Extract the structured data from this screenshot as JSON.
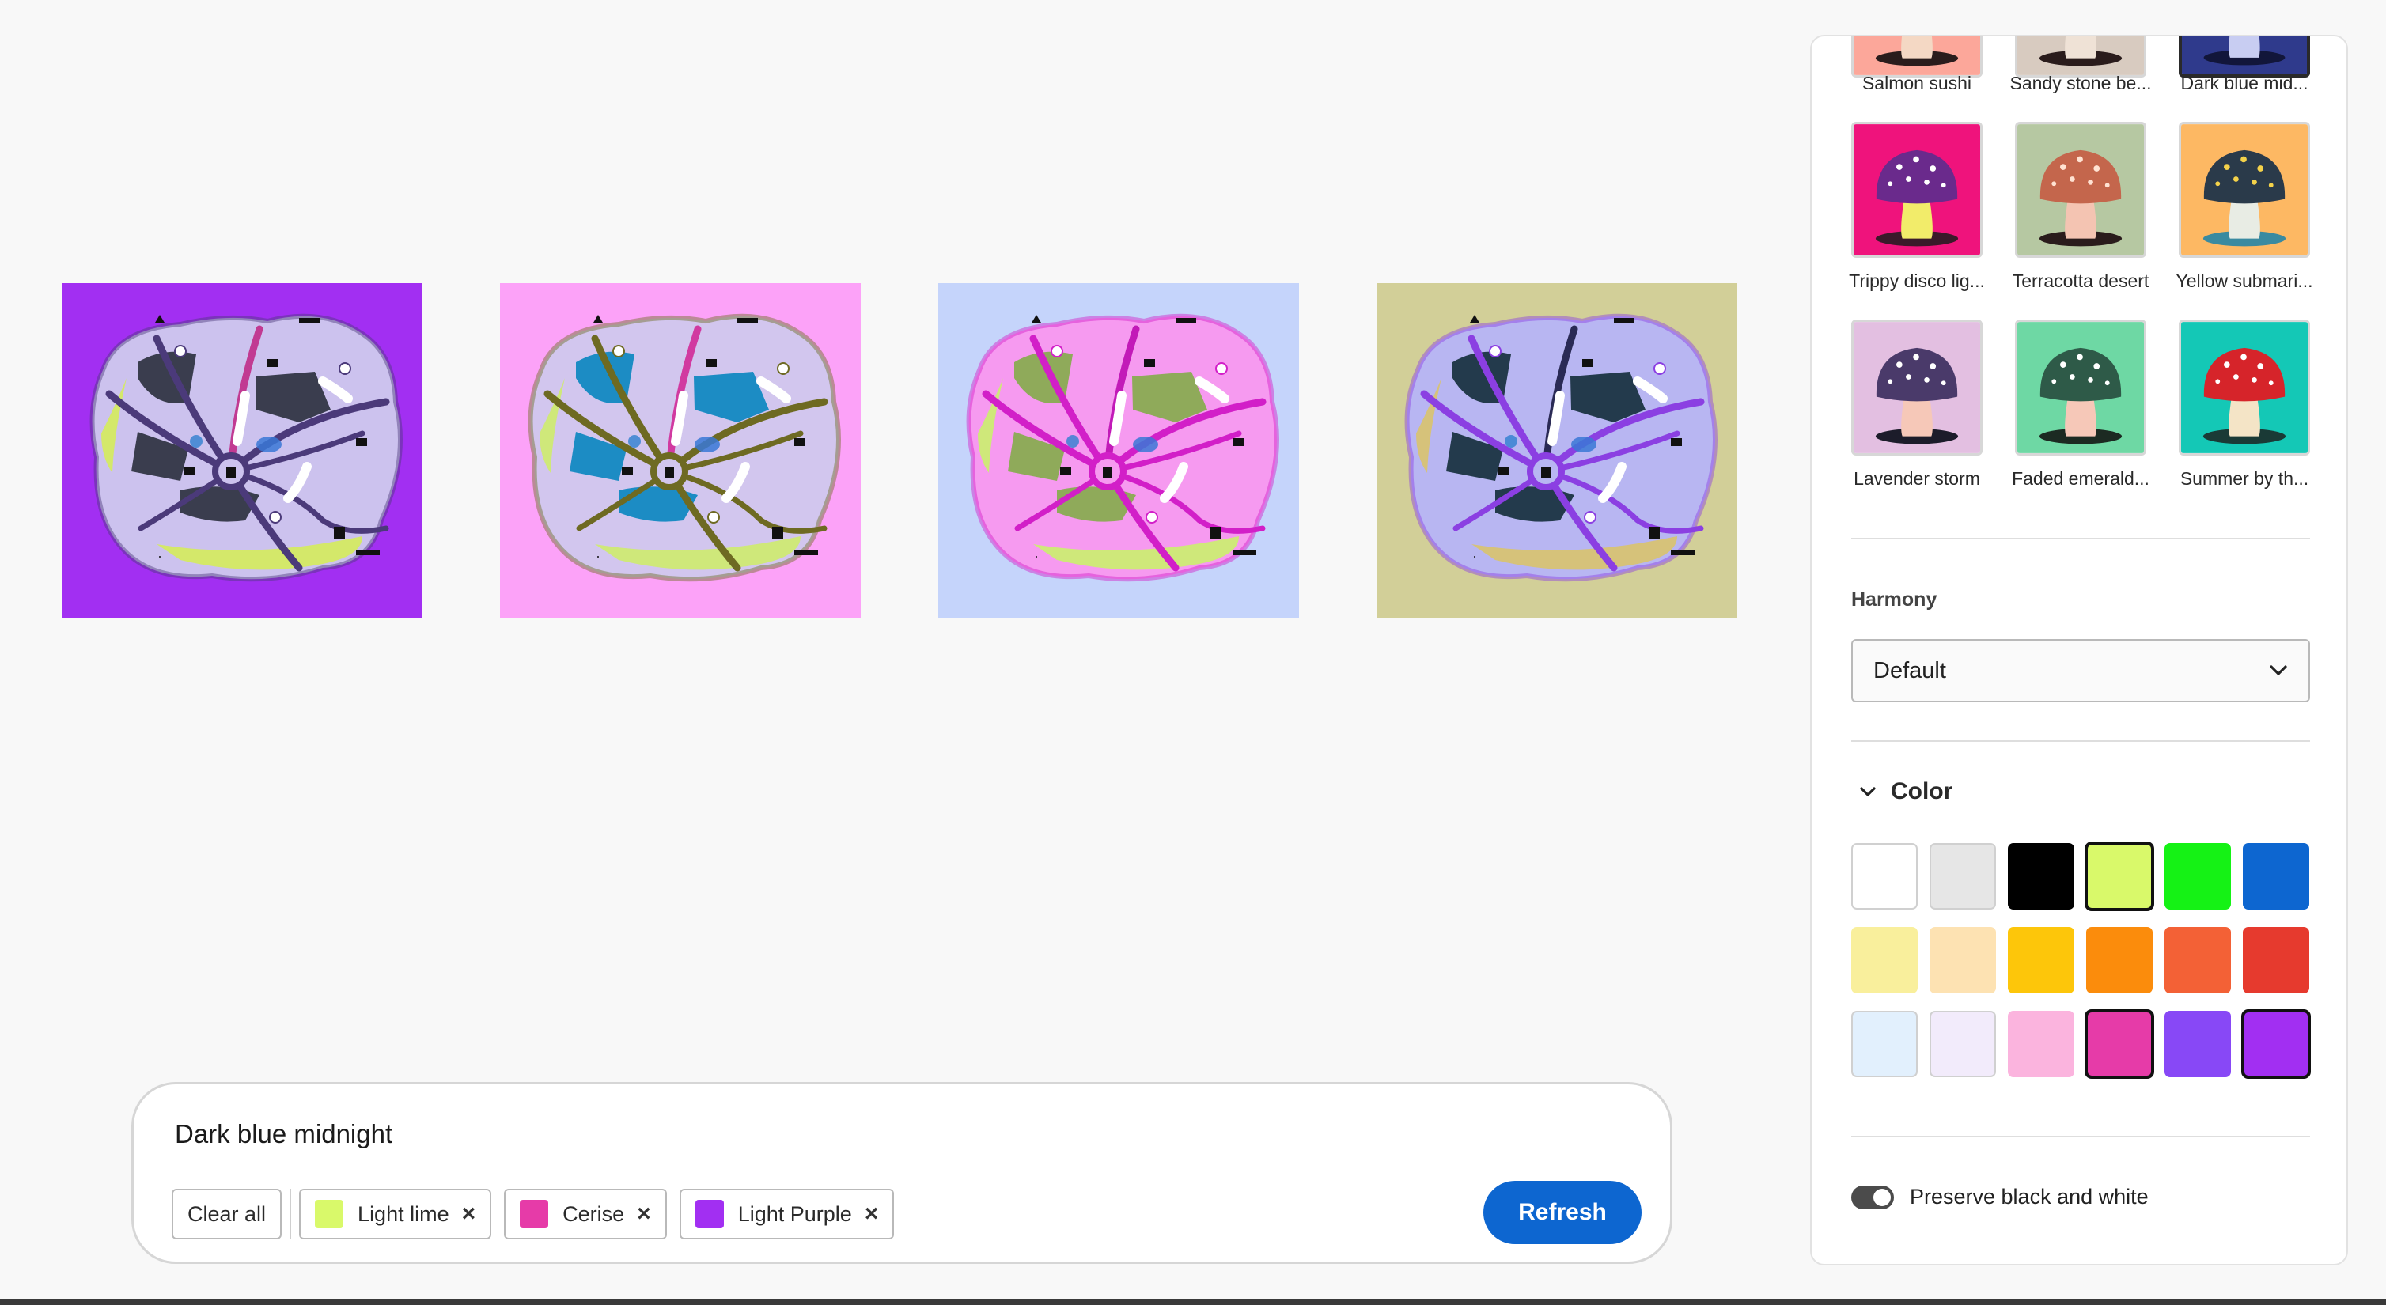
{
  "variants": [
    {
      "bg": "#a22ff2",
      "land": "#ccc2ee",
      "roads": "#4b3a7a",
      "accent": "#c13a92",
      "fields": "#3a3d4e",
      "edge": "#d4e86a"
    },
    {
      "bg": "#fca2f8",
      "land": "#d2c6ee",
      "roads": "#6e6a22",
      "accent": "#d13aa0",
      "fields": "#1c8cc4",
      "edge": "#cfe87a"
    },
    {
      "bg": "#c5d4fb",
      "land": "#f69af0",
      "roads": "#d21fc8",
      "accent": "#c21ab8",
      "fields": "#8faa5a",
      "edge": "#cfe87a"
    },
    {
      "bg": "#d2cf98",
      "land": "#b8b6f2",
      "roads": "#8b3fe2",
      "accent": "#2a2a55",
      "fields": "#233a4c",
      "edge": "#d6c27a"
    }
  ],
  "prompt": {
    "text": "Dark blue midnight",
    "clear_label": "Clear all",
    "chips": [
      {
        "label": "Light lime",
        "color": "#d9f96a"
      },
      {
        "label": "Cerise",
        "color": "#e63ba8"
      },
      {
        "label": "Light Purple",
        "color": "#a22ff2"
      }
    ],
    "remove_glyph": "×",
    "refresh_label": "Refresh"
  },
  "presets": [
    {
      "label": "Salmon sushi",
      "bg": "#fca79a",
      "cap": "#e07a44",
      "spots": "#ffffff",
      "stem": "#f4d8c4",
      "shadow": "#2a1c1c"
    },
    {
      "label": "Sandy stone be...",
      "bg": "#d8cbc0",
      "cap": "#5a4e4a",
      "spots": "#ffffff",
      "stem": "#efe2d6",
      "shadow": "#2a1c1c"
    },
    {
      "label": "Dark blue mid...",
      "bg": "#2f3a8c",
      "cap": "#4a5ab0",
      "spots": "#ffffff",
      "stem": "#c8cdf2",
      "shadow": "#12163a",
      "selected": true
    },
    {
      "label": "Trippy disco lig...",
      "bg": "#ef137c",
      "cap": "#6a2a8c",
      "spots": "#ffffff",
      "stem": "#f2ec6a",
      "shadow": "#3a1a2a"
    },
    {
      "label": "Terracotta desert",
      "bg": "#b6c8a2",
      "cap": "#c4664c",
      "spots": "#ffe2d2",
      "stem": "#f4c4b2",
      "shadow": "#2a1c1c"
    },
    {
      "label": "Yellow submari...",
      "bg": "#fdb863",
      "cap": "#2a3a4a",
      "spots": "#f4d24a",
      "stem": "#e8ece4",
      "shadow": "#3a8aa0"
    },
    {
      "label": "Lavender storm",
      "bg": "#e3bfe1",
      "cap": "#4a3a6a",
      "spots": "#ffffff",
      "stem": "#f6c8b8",
      "shadow": "#1c1c2a"
    },
    {
      "label": "Faded emerald...",
      "bg": "#6ed8a4",
      "cap": "#2e5a48",
      "spots": "#ffffff",
      "stem": "#f6c8b8",
      "shadow": "#1c2a22"
    },
    {
      "label": "Summer by th...",
      "bg": "#14c8b6",
      "cap": "#d6242a",
      "spots": "#ffffff",
      "stem": "#f4e4c6",
      "shadow": "#1a3a36"
    }
  ],
  "harmony": {
    "title": "Harmony",
    "value": "Default"
  },
  "color_section": {
    "title": "Color",
    "swatches": [
      {
        "color": "#ffffff",
        "selected": false
      },
      {
        "color": "#e6e6e6",
        "selected": false
      },
      {
        "color": "#000000",
        "selected": false
      },
      {
        "color": "#d9f96a",
        "selected": true
      },
      {
        "color": "#15f215",
        "selected": false
      },
      {
        "color": "#0d66d0",
        "selected": false
      },
      {
        "color": "#f9ef9c",
        "selected": false
      },
      {
        "color": "#fde2b2",
        "selected": false
      },
      {
        "color": "#fdc60a",
        "selected": false
      },
      {
        "color": "#fb8c0c",
        "selected": false
      },
      {
        "color": "#f36136",
        "selected": false
      },
      {
        "color": "#e63a2e",
        "selected": false
      },
      {
        "color": "#e2f0fd",
        "selected": false
      },
      {
        "color": "#f2ebfb",
        "selected": false
      },
      {
        "color": "#fbb4de",
        "selected": false
      },
      {
        "color": "#e63ba8",
        "selected": true
      },
      {
        "color": "#8848f6",
        "selected": false
      },
      {
        "color": "#a22ff2",
        "selected": true
      }
    ]
  },
  "preserve_bw": {
    "label": "Preserve black and white",
    "on": true
  }
}
